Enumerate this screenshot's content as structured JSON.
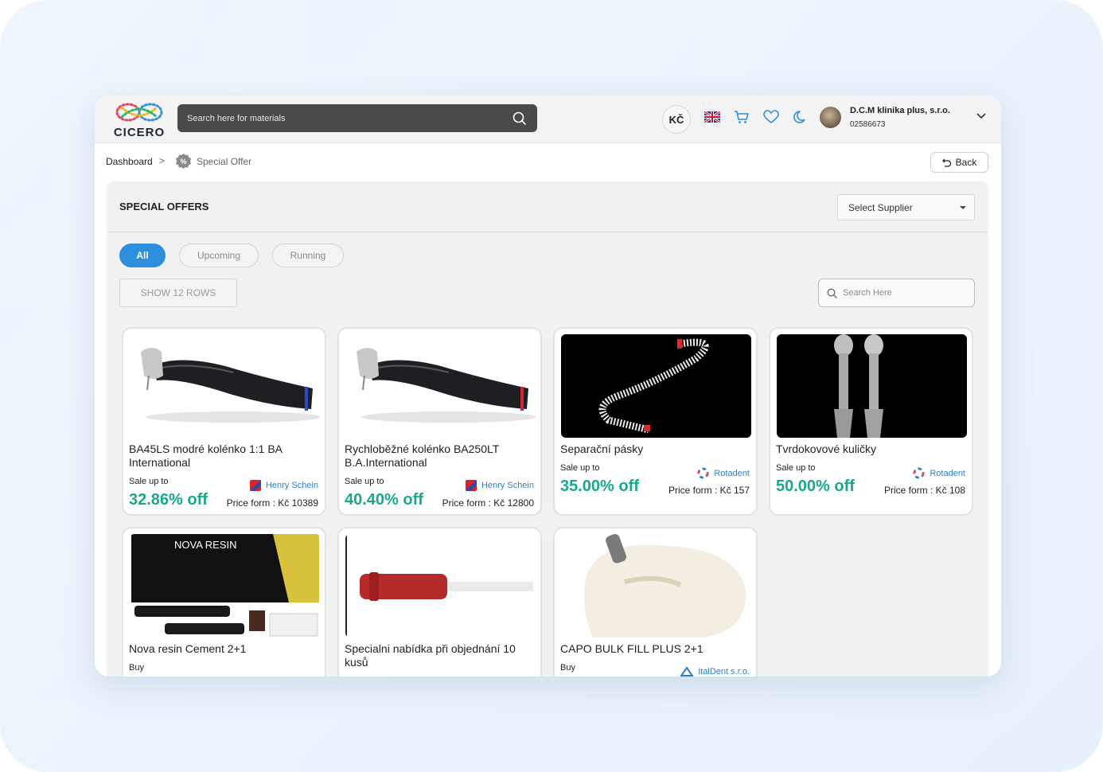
{
  "header": {
    "logo_text": "CICERO",
    "search_placeholder": "Search here for materials",
    "currency": "KČ",
    "company_name": "D.C.M klinika plus, s.r.o.",
    "company_id": "02586673"
  },
  "breadcrumb": {
    "home": "Dashboard",
    "separator": ">",
    "current": "Special Offer",
    "back_label": "Back"
  },
  "panel": {
    "title": "SPECIAL OFFERS",
    "supplier_select": "Select Supplier",
    "tabs": [
      {
        "label": "All",
        "active": true
      },
      {
        "label": "Upcoming",
        "active": false
      },
      {
        "label": "Running",
        "active": false
      }
    ],
    "rows_button": "SHOW 12 ROWS",
    "search_placeholder": "Search Here"
  },
  "offers": [
    {
      "name": "BA45LS modré kolénko 1:1 BA International",
      "sale_label": "Sale up to",
      "discount": "32.86% off",
      "supplier": "Henry Schein",
      "price": "Price form : Kč 10389",
      "image": "handpiece-blue"
    },
    {
      "name": "Rychloběžné kolénko BA250LT B.A.International",
      "sale_label": "Sale up to",
      "discount": "40.40% off",
      "supplier": "Henry Schein",
      "price": "Price form : Kč 12800",
      "image": "handpiece-red"
    },
    {
      "name": "Separační pásky",
      "sale_label": "Sale up to",
      "discount": "35.00% off",
      "supplier": "Rotadent",
      "price": "Price form : Kč 157",
      "image": "separating-strip"
    },
    {
      "name": "Tvrdokovové kuličky",
      "sale_label": "Sale up to",
      "discount": "50.00% off",
      "supplier": "Rotadent",
      "price": "Price form : Kč 108",
      "image": "carbide-burs"
    },
    {
      "name": "Nova resin Cement 2+1",
      "sale_label": "Buy",
      "image": "nova-resin",
      "image_text": "NOVA RESIN"
    },
    {
      "name": "Specialni nabídka při objednání 10 kusů",
      "image": "red-handle-tool"
    },
    {
      "name": "CAPO BULK FILL PLUS 2+1",
      "sale_label": "Buy",
      "supplier": "ItalDent s.r.o.",
      "image": "tooth-filling"
    }
  ],
  "colors": {
    "accent": "#2f8fdf",
    "discount": "#17a98b",
    "supplier_link": "#2d7fd0",
    "search_bar": "#4a4a4a"
  }
}
